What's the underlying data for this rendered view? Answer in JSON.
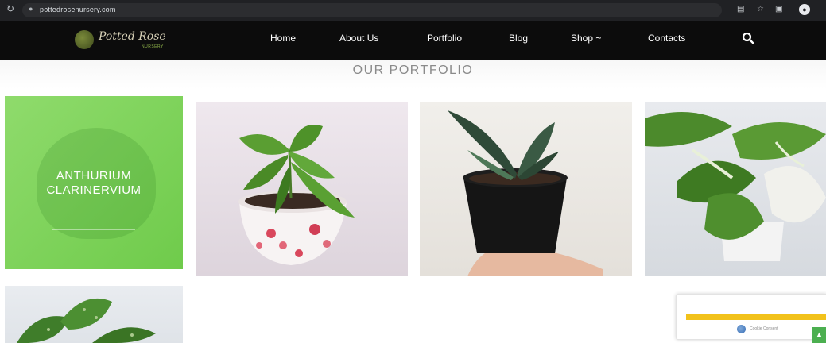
{
  "browser": {
    "url": "pottedrosenursery.com"
  },
  "header": {
    "logo_text": "Potted Rose",
    "logo_tagline": "NURSERY",
    "nav": [
      {
        "label": "Home"
      },
      {
        "label": "About Us"
      },
      {
        "label": "Portfolio"
      },
      {
        "label": "Blog"
      },
      {
        "label": "Shop ~"
      },
      {
        "label": "Contacts"
      }
    ],
    "search_icon": "search-icon"
  },
  "portfolio": {
    "title": "OUR PORTFOLIO",
    "featured": {
      "name_line1": "ANTHURIUM",
      "name_line2": "CLARINERVIUM"
    },
    "items": [
      {
        "image": "plant-in-floral-pot"
      },
      {
        "image": "plant-in-black-pot-held-by-hand"
      },
      {
        "image": "variegated-syngonium"
      },
      {
        "image": "scindapsus-plant"
      }
    ]
  },
  "recaptcha": {
    "label": "Cookie Consent"
  },
  "colors": {
    "header_bg": "#0c0c0c",
    "featured_green": "#7dd35a",
    "captcha_bar": "#f2c21b"
  }
}
